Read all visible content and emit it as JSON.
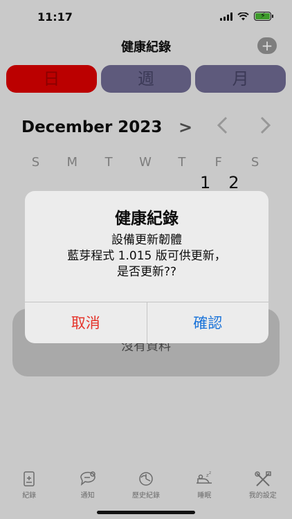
{
  "status_bar": {
    "time": "11:17"
  },
  "header": {
    "title": "健康紀錄",
    "add_icon": "plus-icon"
  },
  "segments": [
    {
      "label": "日",
      "active": true
    },
    {
      "label": "週",
      "active": false
    },
    {
      "label": "月",
      "active": false
    }
  ],
  "calendar": {
    "month": "December 2023",
    "weekdays": [
      "S",
      "M",
      "T",
      "W",
      "T",
      "F",
      "S"
    ],
    "visible_days": [
      "1",
      "2"
    ]
  },
  "empty_state": {
    "text": "沒有資料"
  },
  "alert": {
    "title": "健康紀錄",
    "message": "設備更新韌體\n藍芽程式 1.015 版可供更新，\n是否更新??",
    "cancel_label": "取消",
    "confirm_label": "確認"
  },
  "tab_bar": {
    "items": [
      {
        "label": "紀錄",
        "icon": "record-icon"
      },
      {
        "label": "通知",
        "icon": "notification-icon"
      },
      {
        "label": "歷史紀錄",
        "icon": "history-icon"
      },
      {
        "label": "睡眠",
        "icon": "sleep-icon"
      },
      {
        "label": "我的設定",
        "icon": "settings-icon"
      }
    ]
  },
  "colors": {
    "active_segment": "#bb0000",
    "inactive_segment": "#5e5a7c",
    "cancel": "#e5332a",
    "confirm": "#1a73d9"
  }
}
